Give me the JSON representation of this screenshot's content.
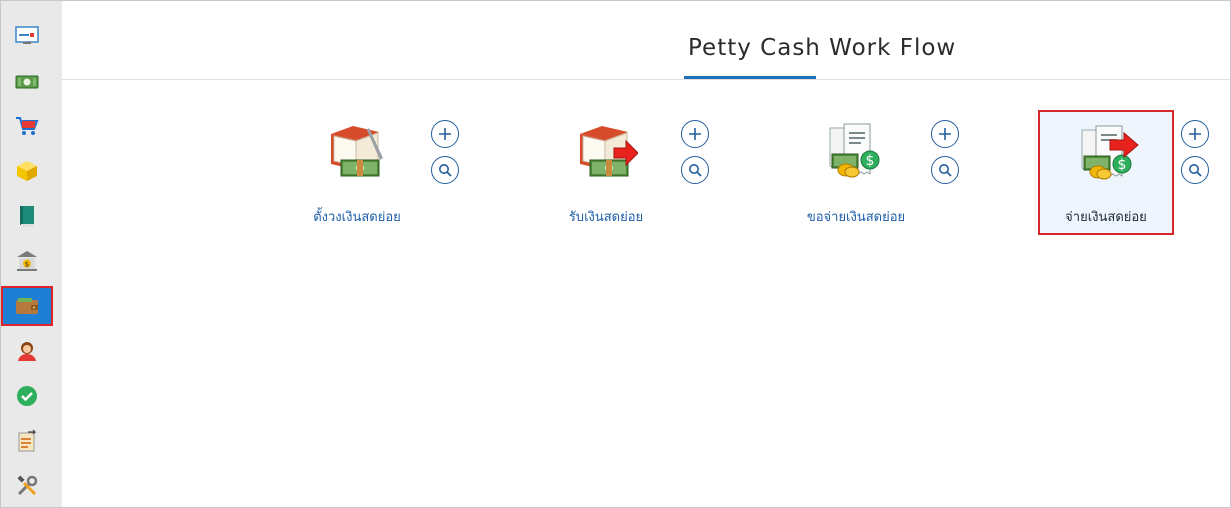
{
  "header": {
    "title": "Petty Cash Work Flow"
  },
  "sidebar": {
    "items": [
      {
        "name": "dashboard-icon"
      },
      {
        "name": "money-icon"
      },
      {
        "name": "cart-icon"
      },
      {
        "name": "box-icon"
      },
      {
        "name": "book-icon"
      },
      {
        "name": "bank-icon"
      },
      {
        "name": "wallet-icon",
        "active": true
      },
      {
        "name": "user-icon"
      },
      {
        "name": "check-icon"
      },
      {
        "name": "document-transfer-icon"
      },
      {
        "name": "tools-icon"
      }
    ]
  },
  "workflow": {
    "cards": [
      {
        "label": "ตั้งวงเงินสดย่อย",
        "icon": "book-money-pen-icon"
      },
      {
        "label": "รับเงินสดย่อย",
        "icon": "book-money-arrow-icon"
      },
      {
        "label": "ขอจ่ายเงินสดย่อย",
        "icon": "documents-money-icon"
      },
      {
        "label": "จ่ายเงินสดย่อย",
        "icon": "documents-money-arrow-icon",
        "selected": true
      }
    ],
    "add_icon": "plus-icon",
    "search_icon": "search-icon"
  },
  "colors": {
    "accent": "#1f6fb8",
    "highlight": "#d9262b",
    "sidebar_bg": "#e9e9e9"
  }
}
